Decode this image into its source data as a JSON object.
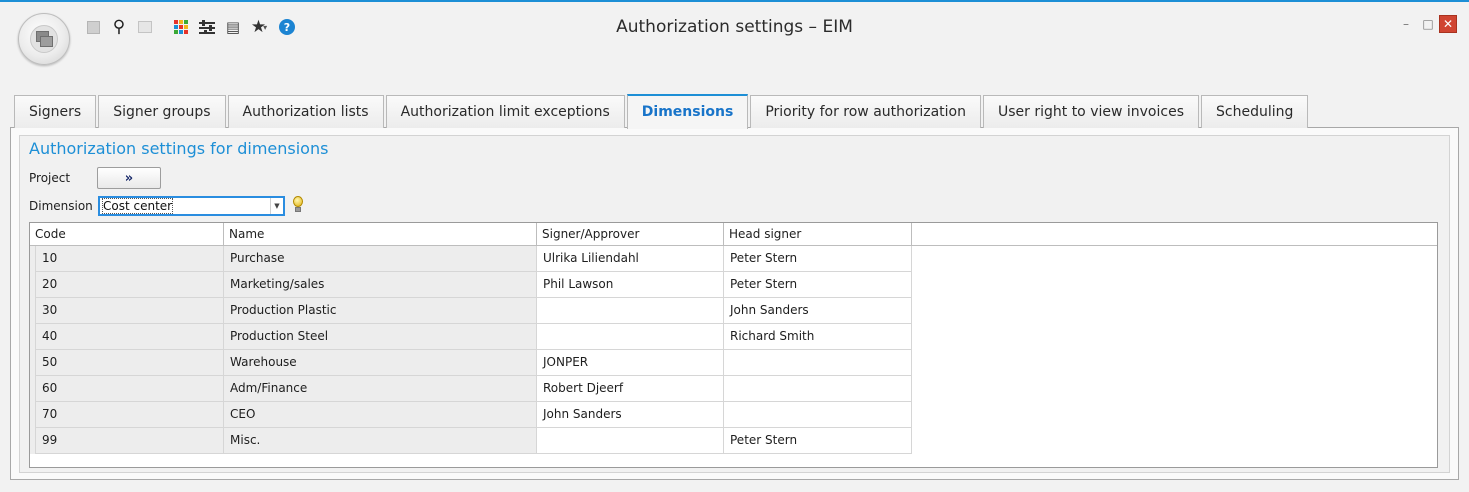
{
  "window": {
    "title": "Authorization settings – EIM",
    "accent": "#1d8fd6",
    "close_color": "#d04532",
    "minimize_glyph": "–",
    "maximize_glyph": "□",
    "close_glyph": "✕"
  },
  "toolbar": {
    "icons": [
      "save-icon",
      "search-icon",
      "document-icon",
      "color-grid-icon",
      "sliders-icon",
      "book-icon",
      "star-icon",
      "help-icon"
    ],
    "help_glyph": "?",
    "star_glyph": "★",
    "drop_glyph": "▾",
    "search_glyph": "⚲"
  },
  "tabs": [
    {
      "label": "Signers",
      "active": false
    },
    {
      "label": "Signer groups",
      "active": false
    },
    {
      "label": "Authorization lists",
      "active": false
    },
    {
      "label": "Authorization limit exceptions",
      "active": false
    },
    {
      "label": "Dimensions",
      "active": true
    },
    {
      "label": "Priority for row authorization",
      "active": false
    },
    {
      "label": "User right to view invoices",
      "active": false
    },
    {
      "label": "Scheduling",
      "active": false
    }
  ],
  "section": {
    "title": "Authorization settings for dimensions",
    "project_label": "Project",
    "project_button": "»",
    "dimension_label": "Dimension",
    "dimension_value": "Cost center"
  },
  "table": {
    "columns": [
      "Code",
      "Name",
      "Signer/Approver",
      "Head signer"
    ],
    "rows": [
      [
        "10",
        "Purchase",
        "Ulrika Liliendahl",
        "Peter Stern"
      ],
      [
        "20",
        "Marketing/sales",
        "Phil Lawson",
        "Peter Stern"
      ],
      [
        "30",
        "Production Plastic",
        "",
        "John Sanders"
      ],
      [
        "40",
        "Production Steel",
        "",
        "Richard Smith"
      ],
      [
        "50",
        "Warehouse",
        "JONPER",
        ""
      ],
      [
        "60",
        "Adm/Finance",
        "Robert Djeerf",
        ""
      ],
      [
        "70",
        "CEO",
        "John Sanders",
        ""
      ],
      [
        "99",
        "Misc.",
        "",
        "Peter Stern"
      ]
    ]
  }
}
